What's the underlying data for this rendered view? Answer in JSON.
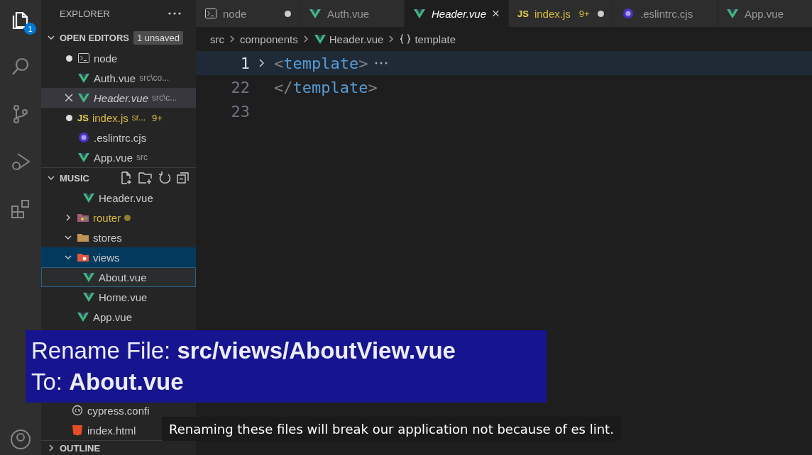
{
  "activity_bar": [
    {
      "kind": "explorer",
      "selected": true,
      "badge": "1"
    },
    {
      "kind": "search",
      "selected": false
    },
    {
      "kind": "source-control",
      "selected": false
    },
    {
      "kind": "run-debug",
      "selected": false
    },
    {
      "kind": "extensions",
      "selected": false
    }
  ],
  "sidebar": {
    "title": "EXPLORER",
    "open_editors": {
      "title": "OPEN EDITORS",
      "badge": "1 unsaved",
      "items": [
        {
          "name": "node",
          "kind": "terminal",
          "dirty": true,
          "selected": false,
          "preview": false,
          "warning": false
        },
        {
          "name": "Auth.vue",
          "description": "src\\co...",
          "kind": "vue",
          "dirty": false,
          "selected": false,
          "preview": false,
          "warning": false
        },
        {
          "name": "Header.vue",
          "description": "src\\c...",
          "kind": "vue",
          "dirty": false,
          "selected": true,
          "preview": true,
          "warning": false
        },
        {
          "name": "index.js",
          "description": "sr...",
          "problems": "9+",
          "kind": "js",
          "icon_label": "JS",
          "dirty": true,
          "selected": false,
          "preview": false,
          "warning": true
        },
        {
          "name": ".eslintrc.cjs",
          "kind": "eslint",
          "dirty": false,
          "selected": false,
          "preview": false,
          "warning": false
        },
        {
          "name": "App.vue",
          "description": "src",
          "kind": "vue",
          "dirty": false,
          "selected": false,
          "preview": false,
          "warning": false
        }
      ]
    },
    "folder": {
      "title": "MUSIC",
      "tree": [
        {
          "children": [
            {
              "children": [
                {
                  "name": "Header.vue",
                  "kind": "vue",
                  "selected": false,
                  "focused": false,
                  "modified": false
                }
              ]
            },
            {
              "name": "router",
              "kind": "folder-router",
              "expanded": false,
              "selected": false,
              "focused": false,
              "modified": true
            },
            {
              "name": "stores",
              "kind": "folder",
              "expanded": true,
              "selected": false,
              "focused": false,
              "modified": false
            },
            {
              "name": "views",
              "kind": "folder-views",
              "expanded": true,
              "selected": true,
              "focused": false,
              "modified": false,
              "children": [
                {
                  "name": "About.vue",
                  "kind": "vue",
                  "selected": false,
                  "focused": true,
                  "modified": false
                },
                {
                  "name": "Home.vue",
                  "kind": "vue",
                  "selected": false,
                  "focused": false,
                  "modified": false
                }
              ]
            },
            {
              "name": "App.vue",
              "kind": "vue",
              "selected": false,
              "focused": false,
              "modified": false
            }
          ]
        },
        {
          "name": "cypress.confi",
          "kind": "cypress",
          "selected": false,
          "focused": false,
          "modified": false
        },
        {
          "name": "index.html",
          "kind": "html",
          "selected": false,
          "focused": false,
          "modified": false
        }
      ]
    },
    "outline": {
      "title": "OUTLINE",
      "expanded": false
    }
  },
  "tabs": [
    {
      "name": "node",
      "kind": "terminal",
      "selected": false,
      "dirty": true,
      "preview": false,
      "warning": false
    },
    {
      "name": "Auth.vue",
      "kind": "vue",
      "selected": false,
      "dirty": false,
      "preview": false,
      "warning": false
    },
    {
      "name": "Header.vue",
      "kind": "vue",
      "selected": true,
      "dirty": false,
      "preview": true,
      "warning": false
    },
    {
      "name": "index.js",
      "problems": "9+",
      "kind": "js",
      "icon_label": "JS",
      "selected": false,
      "dirty": true,
      "preview": false,
      "warning": true
    },
    {
      "name": ".eslintrc.cjs",
      "kind": "eslint",
      "selected": false,
      "dirty": false,
      "preview": false,
      "warning": false
    },
    {
      "name": "App.vue",
      "kind": "vue",
      "selected": false,
      "dirty": false,
      "preview": false,
      "warning": false
    }
  ],
  "breadcrumb": [
    {
      "label": "src",
      "kind": "none"
    },
    {
      "label": "components",
      "kind": "none"
    },
    {
      "label": "Header.vue",
      "kind": "vue"
    },
    {
      "label": "template",
      "kind": "braces"
    }
  ],
  "code_lines": [
    {
      "number": "1",
      "current": true,
      "folded": true,
      "tokens": [
        {
          "kind": "punct",
          "text": "<"
        },
        {
          "kind": "tag",
          "text": "template"
        },
        {
          "kind": "punct",
          "text": ">"
        }
      ]
    },
    {
      "number": "22",
      "current": false,
      "folded": false,
      "tokens": [
        {
          "kind": "punct",
          "text": "</"
        },
        {
          "kind": "tag",
          "text": "template"
        },
        {
          "kind": "punct",
          "text": ">"
        }
      ]
    },
    {
      "number": "23",
      "current": false,
      "folded": false
    }
  ],
  "caption": {
    "lines": [
      "Rename File: **src/views/AboutView.vue**",
      "To: **About.vue**"
    ]
  },
  "subtitle": "Renaming these files will break our application not because of es lint."
}
